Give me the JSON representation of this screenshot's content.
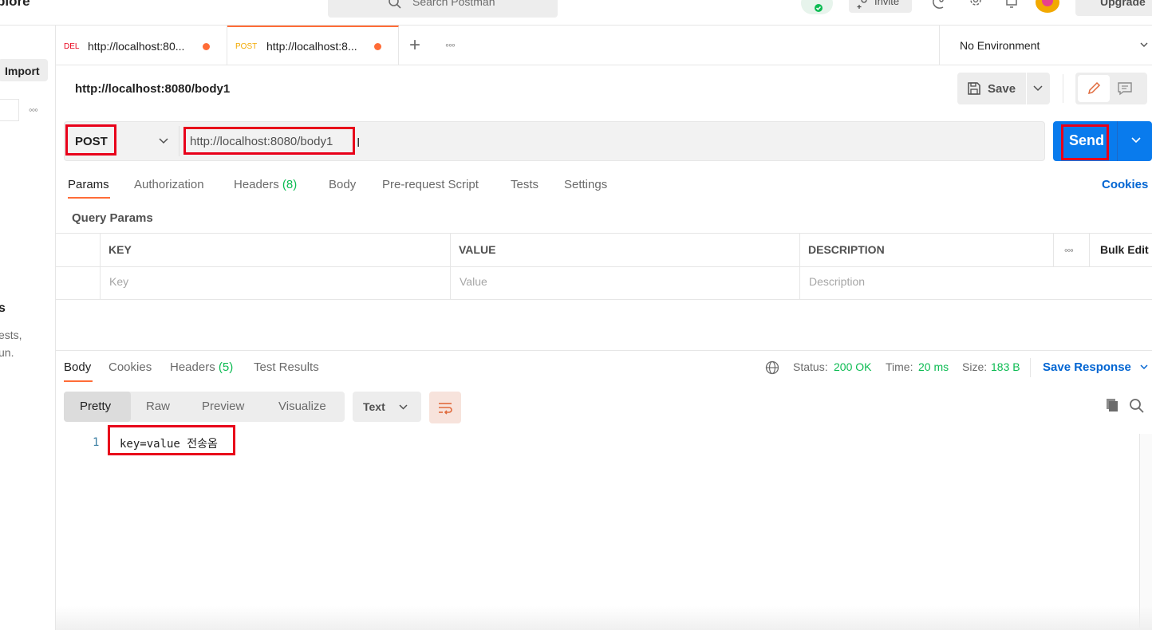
{
  "app": {
    "brand_fragment": "plore",
    "search_placeholder": "Search Postman",
    "invite_label": "Invite",
    "upgrade_label": "Upgrade"
  },
  "sidebar": {
    "import_label": "Import",
    "heading_fragment": "s",
    "text_line1": "ests,",
    "text_line2": "un."
  },
  "tabs": [
    {
      "method": "DEL",
      "method_color": "#e8001a",
      "url": "http://localhost:80...",
      "unsaved": true
    },
    {
      "method": "POST",
      "method_color": "#f2a900",
      "url": "http://localhost:8...",
      "unsaved": true,
      "active": true
    }
  ],
  "environment": {
    "selected": "No Environment"
  },
  "request": {
    "title": "http://localhost:8080/body1",
    "save_label": "Save",
    "method": "POST",
    "url": "http://localhost:8080/body1",
    "send_label": "Send",
    "tabs": [
      {
        "label": "Params"
      },
      {
        "label": "Authorization"
      },
      {
        "label": "Headers",
        "count": "(8)"
      },
      {
        "label": "Body"
      },
      {
        "label": "Pre-request Script"
      },
      {
        "label": "Tests"
      },
      {
        "label": "Settings"
      }
    ],
    "cookies_label": "Cookies",
    "query_params_label": "Query Params",
    "params_table": {
      "headers": [
        "KEY",
        "VALUE",
        "DESCRIPTION"
      ],
      "placeholders": [
        "Key",
        "Value",
        "Description"
      ],
      "bulk_edit_label": "Bulk Edit"
    }
  },
  "response": {
    "tabs": [
      {
        "label": "Body"
      },
      {
        "label": "Cookies"
      },
      {
        "label": "Headers",
        "count": "(5)"
      },
      {
        "label": "Test Results"
      }
    ],
    "status_label": "Status:",
    "status_value": "200 OK",
    "time_label": "Time:",
    "time_value": "20 ms",
    "size_label": "Size:",
    "size_value": "183 B",
    "save_response_label": "Save Response",
    "formats": [
      "Pretty",
      "Raw",
      "Preview",
      "Visualize"
    ],
    "content_type": "Text",
    "lines": [
      {
        "number": "1",
        "text": "key=value 전송옴"
      }
    ]
  },
  "colors": {
    "accent": "#ff6c37",
    "send": "#097bed",
    "success": "#0cbb52",
    "link": "#0265d2",
    "highlight": "#e8001a"
  }
}
